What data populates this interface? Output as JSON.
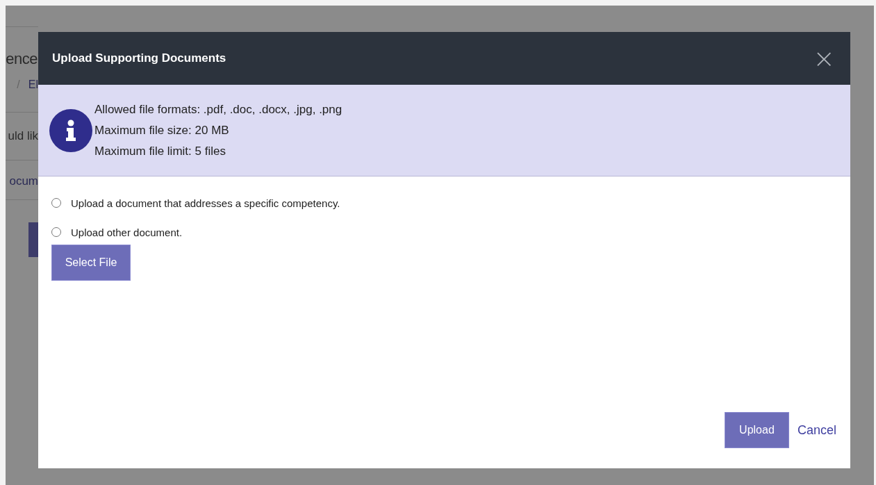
{
  "background_page": {
    "heading": "ence",
    "breadcrumb_separator": "/",
    "breadcrumb": "El",
    "text": "uld lik",
    "link": "ocum"
  },
  "dialog": {
    "title": "Upload Supporting Documents",
    "close": "×",
    "info": [
      "Allowed file formats: .pdf, .doc, .docx, .jpg, .png",
      "Maximum file size: 20 MB",
      "Maximum file limit: 5 files"
    ],
    "options": [
      {
        "label": "Upload a document that addresses a specific competency.",
        "selected": false
      },
      {
        "label": "Upload other document.",
        "selected": false
      }
    ],
    "select_file": "Select File",
    "upload": "Upload",
    "cancel": "Cancel"
  }
}
